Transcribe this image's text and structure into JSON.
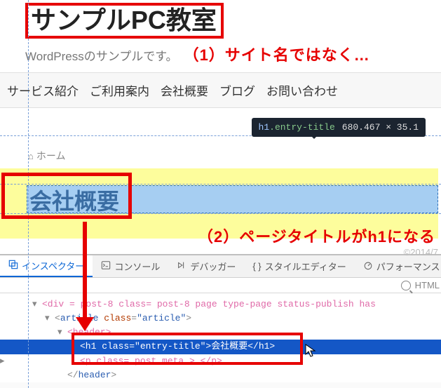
{
  "site": {
    "title": "サンプルPC教室",
    "tagline": "WordPressのサンプルです。"
  },
  "annotations": {
    "a1": "（1）サイト名ではなく…",
    "a2": "（2）ページタイトルがh1になる"
  },
  "nav": {
    "items": [
      "サービス紹介",
      "ご利用案内",
      "会社概要",
      "ブログ",
      "お問い合わせ"
    ]
  },
  "breadcrumb": {
    "home": "ホーム"
  },
  "page_title": "会社概要",
  "date_hint": "©2014/7",
  "tooltip": {
    "tag": "h1",
    "class": ".entry-title",
    "dims": "680.467 × 35.1"
  },
  "devtools": {
    "tabs": {
      "inspector": "インスペクター",
      "console": "コンソール",
      "debugger": "デバッガー",
      "style": "スタイルエディター",
      "perf": "パフォーマンス"
    },
    "search_placeholder": "HTML",
    "dom": {
      "r1": "<div    = post-8  class= post-8 page type-page status-publish has",
      "r2_open": "<",
      "r2_tag": "article",
      "r2_attr": "class",
      "r2_val": "\"article\"",
      "r2_close": ">",
      "r3": "<header>",
      "r4_full": "<h1 class=\"entry-title\">会社概要</h1>",
      "r5": "<p class= post meta >   </p>",
      "r6": "</header>"
    }
  }
}
